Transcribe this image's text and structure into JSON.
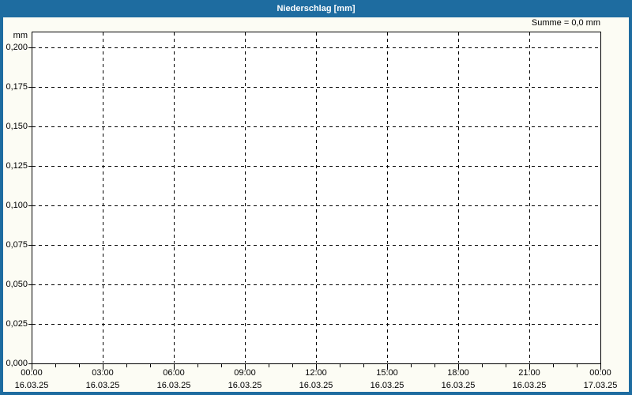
{
  "titlebar": {
    "title": "Niederschlag [mm]"
  },
  "annotations": {
    "sum": "Summe = 0,0 mm"
  },
  "chart_data": {
    "type": "bar",
    "title": "Niederschlag [mm]",
    "ylabel": "mm",
    "xlabel": "",
    "ylim": [
      0,
      0.21
    ],
    "grid": "dashed",
    "legend": "none",
    "y_axis": {
      "unit": "mm",
      "tick_labels": [
        "0,200",
        "0,175",
        "0,150",
        "0,125",
        "0,100",
        "0,075",
        "0,050",
        "0,025",
        "0,000"
      ],
      "tick_values": [
        0.2,
        0.175,
        0.15,
        0.125,
        0.1,
        0.075,
        0.05,
        0.025,
        0.0
      ]
    },
    "x_axis": {
      "major_ticks": [
        {
          "time": "00:00",
          "date": "16.03.25"
        },
        {
          "time": "03:00",
          "date": "16.03.25"
        },
        {
          "time": "06:00",
          "date": "16.03.25"
        },
        {
          "time": "09:00",
          "date": "16.03.25"
        },
        {
          "time": "12:00",
          "date": "16.03.25"
        },
        {
          "time": "15:00",
          "date": "16.03.25"
        },
        {
          "time": "18:00",
          "date": "16.03.25"
        },
        {
          "time": "21:00",
          "date": "16.03.25"
        },
        {
          "time": "00:00",
          "date": "17.03.25"
        }
      ],
      "minor_ticks_per_major": 3,
      "major_interval_hours": 3,
      "minor_interval_hours": 1
    },
    "series": [
      {
        "name": "Niederschlag",
        "values": [],
        "sum_value_mm": 0.0
      }
    ],
    "sum_annotation": "Summe = 0,0 mm",
    "colors": {
      "frame": "#1E6CA0",
      "titlebar_text": "#FFFFFF",
      "panel_background": "#FCFCF4",
      "plot_background": "#FFFFFF",
      "grid_line": "#000000",
      "axis_text": "#000000"
    }
  }
}
